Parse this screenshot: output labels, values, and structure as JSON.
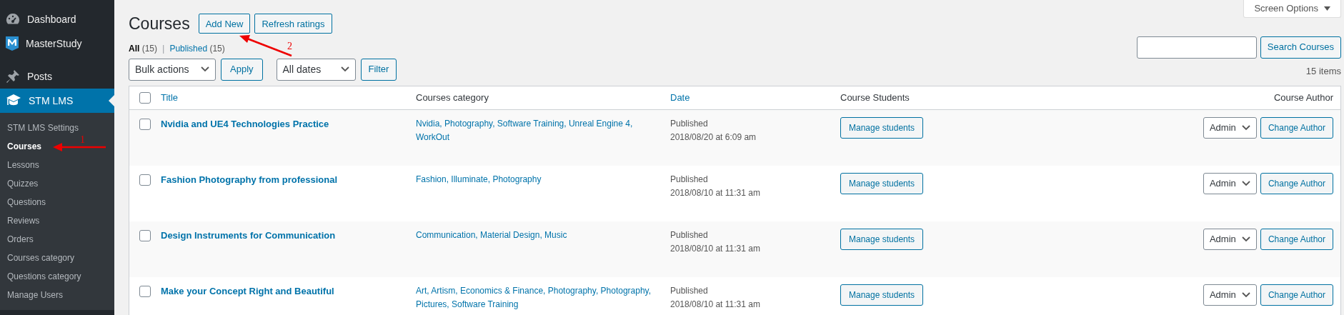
{
  "sidebar": {
    "menu": [
      {
        "label": "Dashboard",
        "selected": false
      },
      {
        "label": "MasterStudy",
        "selected": false
      },
      {
        "label": "Posts",
        "selected": false
      },
      {
        "label": "STM LMS",
        "selected": true
      }
    ],
    "submenu": [
      {
        "label": "STM LMS Settings",
        "selected": false
      },
      {
        "label": "Courses",
        "selected": true
      },
      {
        "label": "Lessons",
        "selected": false
      },
      {
        "label": "Quizzes",
        "selected": false
      },
      {
        "label": "Questions",
        "selected": false
      },
      {
        "label": "Reviews",
        "selected": false
      },
      {
        "label": "Orders",
        "selected": false
      },
      {
        "label": "Courses category",
        "selected": false
      },
      {
        "label": "Questions category",
        "selected": false
      },
      {
        "label": "Manage Users",
        "selected": false
      }
    ]
  },
  "screen_options": "Screen Options",
  "title": "Courses",
  "title_buttons": [
    "Add New",
    "Refresh ratings"
  ],
  "views_separator": "|",
  "views": [
    {
      "label": "All",
      "count": "(15)",
      "selected": true
    },
    {
      "label": "Published",
      "count": "(15)",
      "selected": false
    }
  ],
  "search": {
    "button": "Search Courses"
  },
  "bulk_actions": "Bulk actions",
  "apply": "Apply",
  "dates": "All dates",
  "filter": "Filter",
  "items_count": "15 items",
  "table": {
    "all_checked": false,
    "columns": [
      {
        "label": "Title",
        "sortable": true
      },
      {
        "label": "Courses category",
        "sortable": false
      },
      {
        "label": "Date",
        "sortable": true
      },
      {
        "label": "Course Students",
        "sortable": false
      },
      {
        "label": "Course Author",
        "sortable": false
      }
    ],
    "rows": [
      {
        "checked": false,
        "title": "Nvidia and UE4 Technologies Practice",
        "categories": "Nvidia, Photography, Software Training, Unreal Engine 4, WorkOut",
        "status": "Published",
        "date": "2018/08/20 at 6:09 am",
        "students_button": "Manage students",
        "author": "Admin",
        "change_author": "Change Author"
      },
      {
        "checked": false,
        "title": "Fashion Photography from professional",
        "categories": "Fashion, Illuminate, Photography",
        "status": "Published",
        "date": "2018/08/10 at 11:31 am",
        "students_button": "Manage students",
        "author": "Admin",
        "change_author": "Change Author"
      },
      {
        "checked": false,
        "title": "Design Instruments for Communication",
        "categories": "Communication, Material Design, Music",
        "status": "Published",
        "date": "2018/08/10 at 11:31 am",
        "students_button": "Manage students",
        "author": "Admin",
        "change_author": "Change Author"
      },
      {
        "checked": false,
        "title": "Make your Concept Right and Beautiful",
        "categories": "Art, Artism, Economics & Finance, Photography, Photography, Pictures, Software Training",
        "status": "Published",
        "date": "2018/08/10 at 11:31 am",
        "students_button": "Manage students",
        "author": "Admin",
        "change_author": "Change Author"
      }
    ]
  },
  "annotations": [
    {
      "label": "1"
    },
    {
      "label": "2"
    }
  ]
}
